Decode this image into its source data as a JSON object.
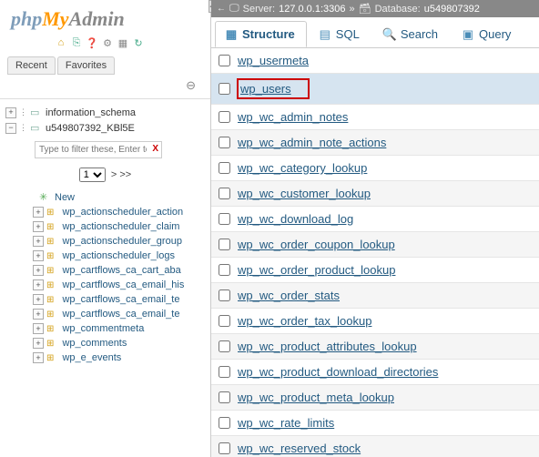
{
  "logo": {
    "p1": "php",
    "p2": "My",
    "p3": "Admin"
  },
  "left_tabs": {
    "recent": "Recent",
    "favorites": "Favorites"
  },
  "tree": {
    "info_schema": "information_schema",
    "current_db": "u549807392_KBl5E",
    "filter_placeholder": "Type to filter these, Enter to se",
    "page_select": "1",
    "pager_next": "> >>",
    "new_label": "New",
    "tables": [
      "wp_actionscheduler_action",
      "wp_actionscheduler_claim",
      "wp_actionscheduler_group",
      "wp_actionscheduler_logs",
      "wp_cartflows_ca_cart_aba",
      "wp_cartflows_ca_email_his",
      "wp_cartflows_ca_email_te",
      "wp_cartflows_ca_email_te",
      "wp_commentmeta",
      "wp_comments",
      "wp_e_events"
    ]
  },
  "server_bar": {
    "server_label": "Server:",
    "server_value": "127.0.0.1:3306",
    "db_label": "Database:",
    "db_value": "u549807392"
  },
  "top_tabs": {
    "structure": "Structure",
    "sql": "SQL",
    "search": "Search",
    "query": "Query"
  },
  "main_tables": [
    {
      "name": "wp_usermeta",
      "alt": false,
      "sel": false,
      "highlight": false
    },
    {
      "name": "wp_users",
      "alt": true,
      "sel": true,
      "highlight": true
    },
    {
      "name": "wp_wc_admin_notes",
      "alt": false,
      "sel": false,
      "highlight": false
    },
    {
      "name": "wp_wc_admin_note_actions",
      "alt": true,
      "sel": false,
      "highlight": false
    },
    {
      "name": "wp_wc_category_lookup",
      "alt": false,
      "sel": false,
      "highlight": false
    },
    {
      "name": "wp_wc_customer_lookup",
      "alt": true,
      "sel": false,
      "highlight": false
    },
    {
      "name": "wp_wc_download_log",
      "alt": false,
      "sel": false,
      "highlight": false
    },
    {
      "name": "wp_wc_order_coupon_lookup",
      "alt": true,
      "sel": false,
      "highlight": false
    },
    {
      "name": "wp_wc_order_product_lookup",
      "alt": false,
      "sel": false,
      "highlight": false
    },
    {
      "name": "wp_wc_order_stats",
      "alt": true,
      "sel": false,
      "highlight": false
    },
    {
      "name": "wp_wc_order_tax_lookup",
      "alt": false,
      "sel": false,
      "highlight": false
    },
    {
      "name": "wp_wc_product_attributes_lookup",
      "alt": true,
      "sel": false,
      "highlight": false
    },
    {
      "name": "wp_wc_product_download_directories",
      "alt": false,
      "sel": false,
      "highlight": false
    },
    {
      "name": "wp_wc_product_meta_lookup",
      "alt": true,
      "sel": false,
      "highlight": false
    },
    {
      "name": "wp_wc_rate_limits",
      "alt": false,
      "sel": false,
      "highlight": false
    },
    {
      "name": "wp_wc_reserved_stock",
      "alt": true,
      "sel": false,
      "highlight": false
    }
  ]
}
